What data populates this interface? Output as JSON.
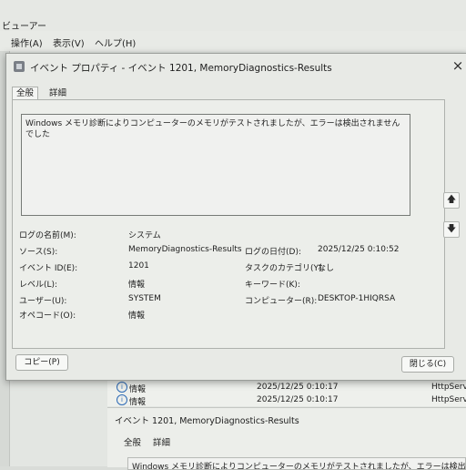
{
  "background": {
    "window_title": "ビューアー",
    "menu": [
      "操作(A)",
      "表示(V)",
      "ヘルプ(H)"
    ],
    "rows": [
      {
        "level": "情報",
        "date": "2025/12/25 0:10:17",
        "source": "HttpServ"
      },
      {
        "level": "情報",
        "date": "2025/12/25 0:10:17",
        "source": "HttpServ"
      }
    ],
    "detail_title": "イベント 1201, MemoryDiagnostics-Results",
    "detail_tabs": [
      "全般",
      "詳細"
    ],
    "detail_message": "Windows メモリ診断によりコンピューターのメモリがテストされましたが、エラーは検出されませんでした"
  },
  "dialog": {
    "title": "イベント プロパティ - イベント 1201, MemoryDiagnostics-Results",
    "close_glyph": "×",
    "tabs": [
      "全般",
      "詳細"
    ],
    "message": "Windows メモリ診断によりコンピューターのメモリがテストされましたが、エラーは検出されませんでした",
    "up_glyph": "🡅",
    "down_glyph": "🡇",
    "fields": {
      "log_name_label": "ログの名前(M):",
      "log_name": "システム",
      "source_label": "ソース(S):",
      "source": "MemoryDiagnostics-Results",
      "logged_label": "ログの日付(D):",
      "logged": "2025/12/25 0:10:52",
      "event_id_label": "イベント ID(E):",
      "event_id": "1201",
      "task_label": "タスクのカテゴリ(Y):",
      "task": "なし",
      "level_label": "レベル(L):",
      "level": "情報",
      "keywords_label": "キーワード(K):",
      "keywords": "",
      "user_label": "ユーザー(U):",
      "user": "SYSTEM",
      "computer_label": "コンピューター(R):",
      "computer": "DESKTOP-1HIQRSA",
      "opcode_label": "オペコード(O):",
      "opcode": "情報"
    },
    "copy_button": "コピー(P)",
    "close_button": "閉じる(C)"
  },
  "colors": {
    "dialog_bg": "#e8eae6",
    "info_icon": "#2d6ab5"
  }
}
